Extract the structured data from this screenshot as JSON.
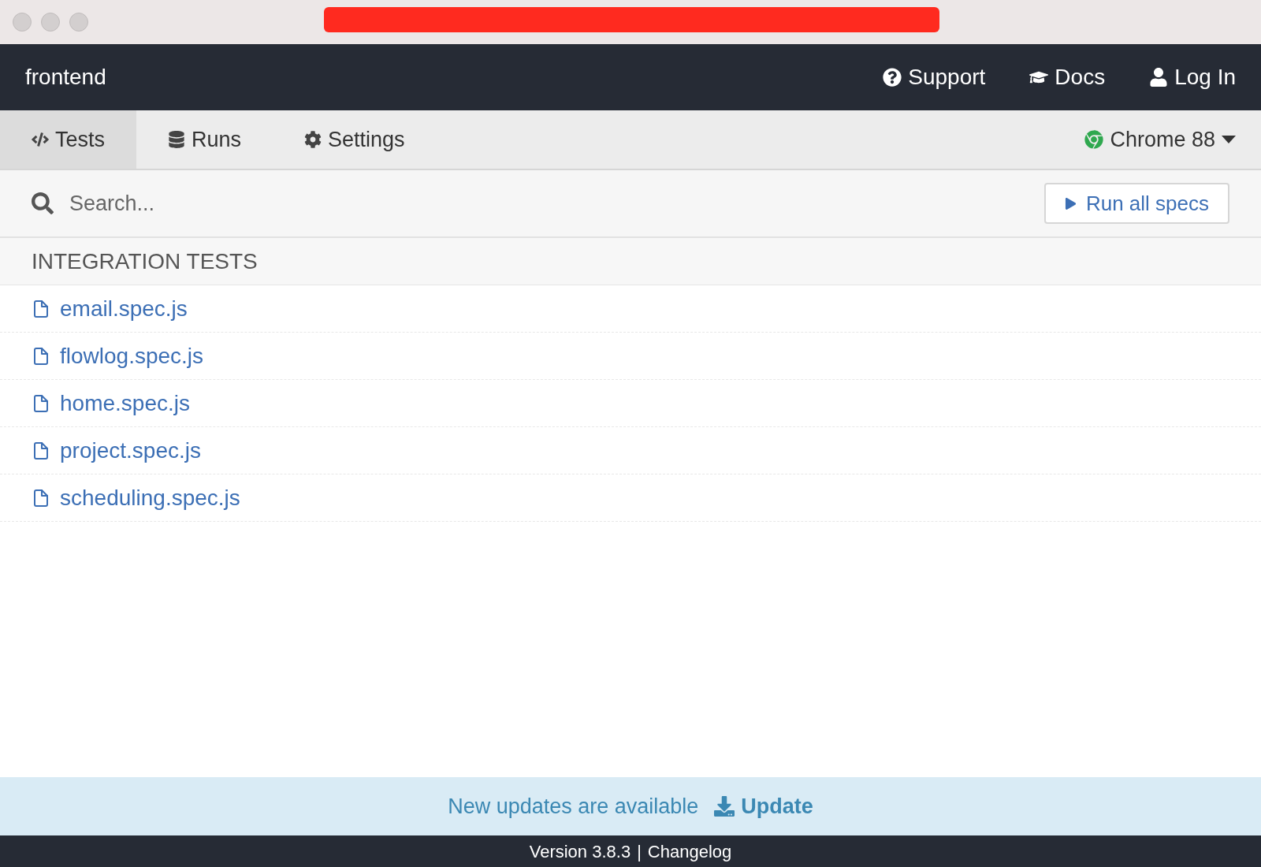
{
  "navbar": {
    "project": "frontend",
    "links": [
      {
        "kind": "support",
        "label": "Support"
      },
      {
        "kind": "docs",
        "label": "Docs"
      },
      {
        "kind": "login",
        "label": "Log In"
      }
    ]
  },
  "tabs": [
    {
      "kind": "tests",
      "label": "Tests",
      "selected": true
    },
    {
      "kind": "runs",
      "label": "Runs",
      "selected": false
    },
    {
      "kind": "settings",
      "label": "Settings",
      "selected": false
    }
  ],
  "browser": {
    "label": "Chrome 88"
  },
  "search": {
    "placeholder": "Search..."
  },
  "run_button": "Run all specs",
  "section": {
    "title": "INTEGRATION TESTS",
    "files": [
      "email.spec.js",
      "flowlog.spec.js",
      "home.spec.js",
      "project.spec.js",
      "scheduling.spec.js"
    ]
  },
  "update_bar": {
    "message": "New updates are available",
    "action": "Update"
  },
  "footer": {
    "version": "Version 3.8.3",
    "separator": "|",
    "changelog": "Changelog"
  }
}
